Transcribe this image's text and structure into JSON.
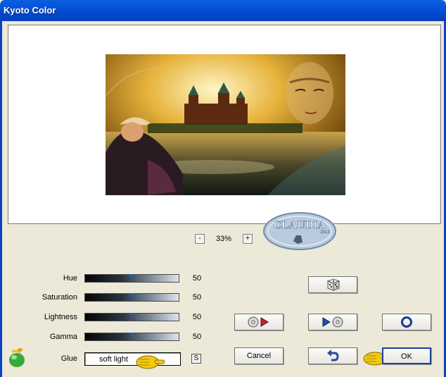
{
  "window": {
    "title": "Kyoto Color"
  },
  "zoom": {
    "minus": "-",
    "level": "33%",
    "plus": "+"
  },
  "watermark": {
    "text": "CLAUDIA",
    "year": "2013"
  },
  "sliders": [
    {
      "label": "Hue",
      "value": "50"
    },
    {
      "label": "Saturation",
      "value": "50"
    },
    {
      "label": "Lightness",
      "value": "50"
    },
    {
      "label": "Gamma",
      "value": "50"
    }
  ],
  "glue": {
    "label": "Glue",
    "value": "soft light",
    "s_button": "S"
  },
  "buttons": {
    "cancel": "Cancel",
    "ok": "OK"
  },
  "colors": {
    "titlebar": "#0553d6",
    "window_bg": "#ece9d8",
    "slider_thumb": "#2c5d8e",
    "ok_focus": "#1a3fa0"
  }
}
